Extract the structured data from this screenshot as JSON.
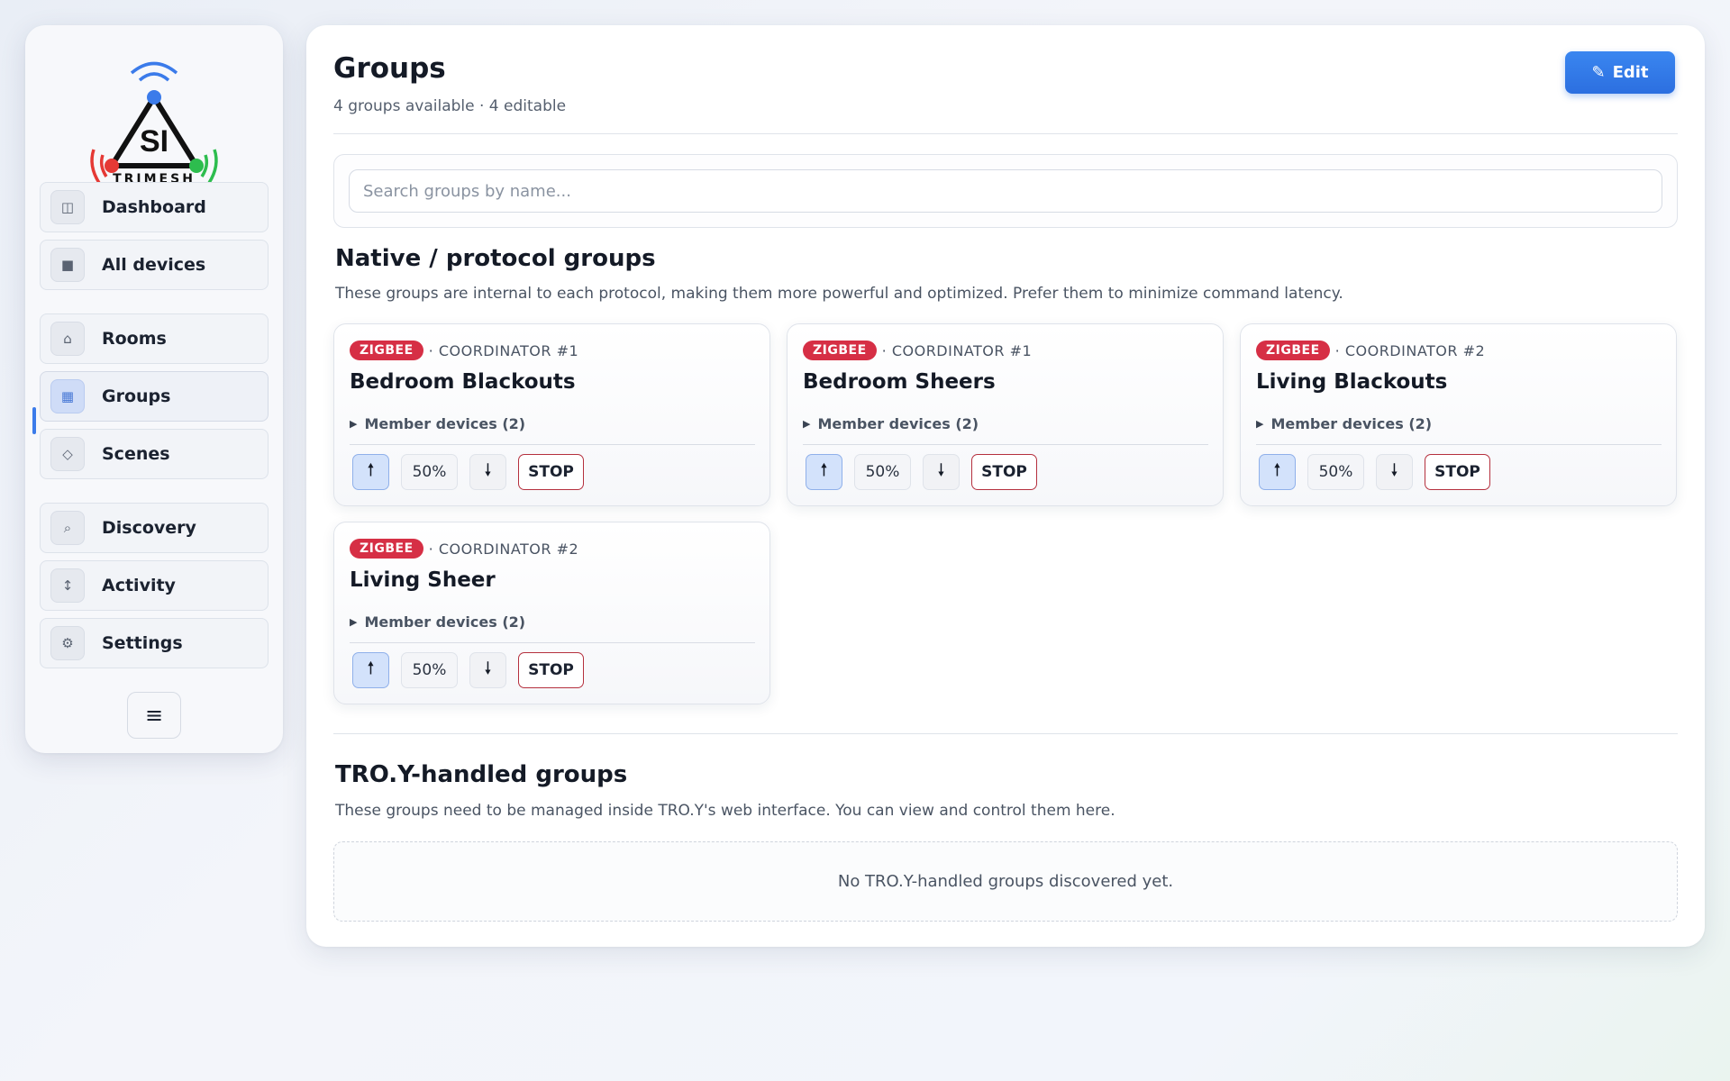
{
  "sidebar": {
    "logo": {
      "text": "TRIMESH",
      "mark": "SI"
    },
    "items": [
      {
        "label": "Dashboard",
        "icon": "dashboard-icon",
        "glyph": "◫"
      },
      {
        "label": "All devices",
        "icon": "devices-icon",
        "glyph": "■"
      },
      {
        "label": "Rooms",
        "icon": "home-icon",
        "glyph": "⌂"
      },
      {
        "label": "Groups",
        "icon": "groups-icon",
        "glyph": "▦",
        "active": true
      },
      {
        "label": "Scenes",
        "icon": "diamond-icon",
        "glyph": "◇"
      },
      {
        "label": "Discovery",
        "icon": "search-icon",
        "glyph": "⌕"
      },
      {
        "label": "Activity",
        "icon": "arrows-vertical-icon",
        "glyph": "↕"
      },
      {
        "label": "Settings",
        "icon": "gear-icon",
        "glyph": "⚙"
      }
    ],
    "menu_glyph": "≡"
  },
  "header": {
    "title": "Groups",
    "subtitle": "4 groups available · 4 editable",
    "edit_label": "Edit",
    "edit_glyph": "✎"
  },
  "search": {
    "placeholder": "Search groups by name...",
    "value": ""
  },
  "native": {
    "title": "Native / protocol groups",
    "description": "These groups are internal to each protocol, making them more powerful and optimized. Prefer them to minimize command latency.",
    "groups": [
      {
        "protocol": "ZIGBEE",
        "coordinator": "· COORDINATOR #1",
        "name": "Bedroom Blackouts",
        "members": "Member devices (2)",
        "position": "50%",
        "up": "🠕",
        "down": "🠗",
        "stop": "STOP"
      },
      {
        "protocol": "ZIGBEE",
        "coordinator": "· COORDINATOR #1",
        "name": "Bedroom Sheers",
        "members": "Member devices (2)",
        "position": "50%",
        "up": "🠕",
        "down": "🠗",
        "stop": "STOP"
      },
      {
        "protocol": "ZIGBEE",
        "coordinator": "· COORDINATOR #2",
        "name": "Living Blackouts",
        "members": "Member devices (2)",
        "position": "50%",
        "up": "🠕",
        "down": "🠗",
        "stop": "STOP"
      },
      {
        "protocol": "ZIGBEE",
        "coordinator": "· COORDINATOR #2",
        "name": "Living Sheer",
        "members": "Member devices (2)",
        "position": "50%",
        "up": "🠕",
        "down": "🠗",
        "stop": "STOP"
      }
    ]
  },
  "troy": {
    "title": "TRO.Y-handled groups",
    "description": "These groups need to be managed inside TRO.Y's web interface. You can view and control them here.",
    "empty_text": "No TRO.Y-handled groups discovered yet."
  },
  "colors": {
    "accent": "#3b7bea",
    "zigbee": "#d62f45",
    "stop_border": "#b5303e"
  }
}
